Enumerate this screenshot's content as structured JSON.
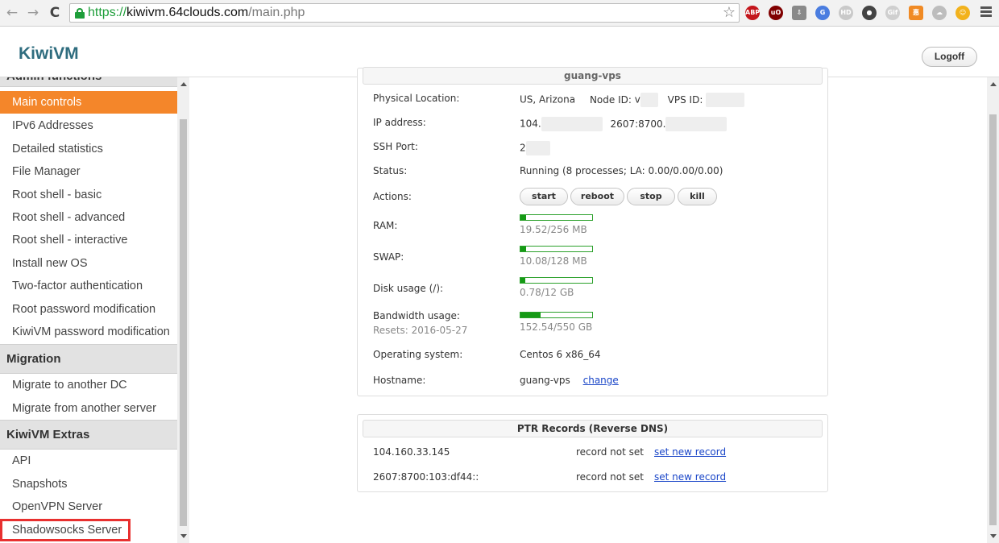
{
  "browser": {
    "url_scheme": "https://",
    "url_host": "kiwivm.64clouds.com",
    "url_path": "/main.php",
    "extensions": [
      {
        "name": "adblock-plus-icon",
        "label": "ABP",
        "color": "#c4161c"
      },
      {
        "name": "ublock-icon",
        "label": "uO",
        "color": "#800000"
      },
      {
        "name": "download-icon",
        "label": "⇩",
        "color": "#8a8a8a"
      },
      {
        "name": "translate-icon",
        "label": "G",
        "color": "#4a7de0"
      },
      {
        "name": "hd-icon",
        "label": "HD",
        "color": "#c9c9c9"
      },
      {
        "name": "lightbulb-icon",
        "label": "●",
        "color": "#444444"
      },
      {
        "name": "gif-icon",
        "label": "Gif",
        "color": "#cfcfcf"
      },
      {
        "name": "orange-square-icon",
        "label": "惠",
        "color": "#f08a24"
      },
      {
        "name": "cloud-icon",
        "label": "☁",
        "color": "#bdbdbd"
      },
      {
        "name": "smiley-icon",
        "label": "☺",
        "color": "#f2b21c"
      }
    ]
  },
  "header": {
    "logo": "KiwiVM",
    "logoff": "Logoff"
  },
  "sidebar": {
    "sections": [
      {
        "title": "Admin functions",
        "items": [
          {
            "label": "Main controls",
            "active": true
          },
          {
            "label": "IPv6 Addresses"
          },
          {
            "label": "Detailed statistics"
          },
          {
            "label": "File Manager"
          },
          {
            "label": "Root shell - basic"
          },
          {
            "label": "Root shell - advanced"
          },
          {
            "label": "Root shell - interactive"
          },
          {
            "label": "Install new OS"
          },
          {
            "label": "Two-factor authentication"
          },
          {
            "label": "Root password modification"
          },
          {
            "label": "KiwiVM password modification"
          }
        ]
      },
      {
        "title": "Migration",
        "items": [
          {
            "label": "Migrate to another DC"
          },
          {
            "label": "Migrate from another server"
          }
        ]
      },
      {
        "title": "KiwiVM Extras",
        "items": [
          {
            "label": "API"
          },
          {
            "label": "Snapshots"
          },
          {
            "label": "OpenVPN Server"
          },
          {
            "label": "Shadowsocks Server",
            "highlighted": true
          }
        ]
      }
    ]
  },
  "vps": {
    "panel_title": "guang-vps",
    "location_label": "Physical Location:",
    "location_value": "US, Arizona",
    "node_label": "Node ID:",
    "node_value": "v",
    "vpsid_label": "VPS ID:",
    "ip_label": "IP address:",
    "ipv4": "104.",
    "ipv6": "2607:8700.",
    "ssh_label": "SSH Port:",
    "ssh_value": "2",
    "status_label": "Status:",
    "status_value": "Running (8 processes; LA: 0.00/0.00/0.00)",
    "actions_label": "Actions:",
    "actions": [
      "start",
      "reboot",
      "stop",
      "kill"
    ],
    "ram_label": "RAM:",
    "ram_text": "19.52/256 MB",
    "ram_fraction": 0.076,
    "swap_label": "SWAP:",
    "swap_text": "10.08/128 MB",
    "swap_fraction": 0.079,
    "disk_label": "Disk usage (/):",
    "disk_text": "0.78/12 GB",
    "disk_fraction": 0.065,
    "bw_label": "Bandwidth usage:",
    "bw_resets": "Resets: 2016-05-27",
    "bw_text": "152.54/550 GB",
    "bw_fraction": 0.277,
    "os_label": "Operating system:",
    "os_value": "Centos 6 x86_64",
    "hostname_label": "Hostname:",
    "hostname_value": "guang-vps",
    "change_link": "change"
  },
  "ptr": {
    "title": "PTR Records (Reverse DNS)",
    "rows": [
      {
        "address": "104.160.33.145",
        "status": "record not set",
        "link": "set new record"
      },
      {
        "address": "2607:8700:103:df44::",
        "status": "record not set",
        "link": "set new record"
      }
    ]
  }
}
